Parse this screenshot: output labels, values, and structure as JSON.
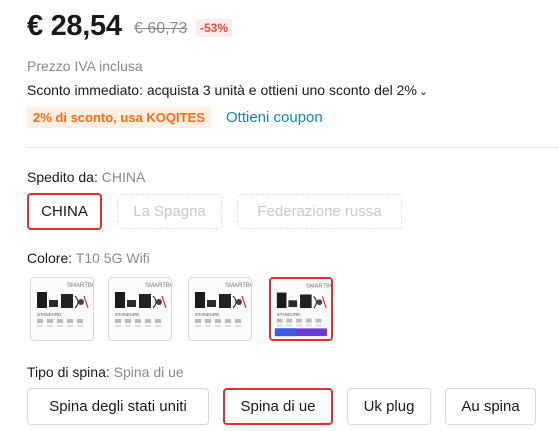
{
  "price": {
    "current": "€ 28,54",
    "original": "€ 60,73",
    "discount": "-53%",
    "vat_note": "Prezzo IVA inclusa",
    "instant_discount": "Sconto immediato: acquista 3 unità e ottieni uno sconto del 2%",
    "instant_chevron": "⌄",
    "coupon_code_text": "2% di sconto, usa KOQITES",
    "coupon_link": "Ottieni coupon"
  },
  "shipping": {
    "label": "Spedito da: ",
    "selected": "CHINA",
    "options": [
      "CHINA",
      "La Spagna",
      "Federazione russa"
    ]
  },
  "color": {
    "label": "Colore: ",
    "selected": "T10 5G Wifi",
    "thumb_brand": "SMARTBOX",
    "thumb_caption": "STANDARD"
  },
  "plug": {
    "label": "Tipo di spina: ",
    "selected": "Spina di ue",
    "options": [
      "Spina degli stati uniti",
      "Spina di ue",
      "Uk plug",
      "Au spina"
    ]
  },
  "colors": {
    "accent_red": "#e52f2f",
    "coupon_orange": "#fd6b13",
    "link_blue": "#0b8ab8"
  }
}
